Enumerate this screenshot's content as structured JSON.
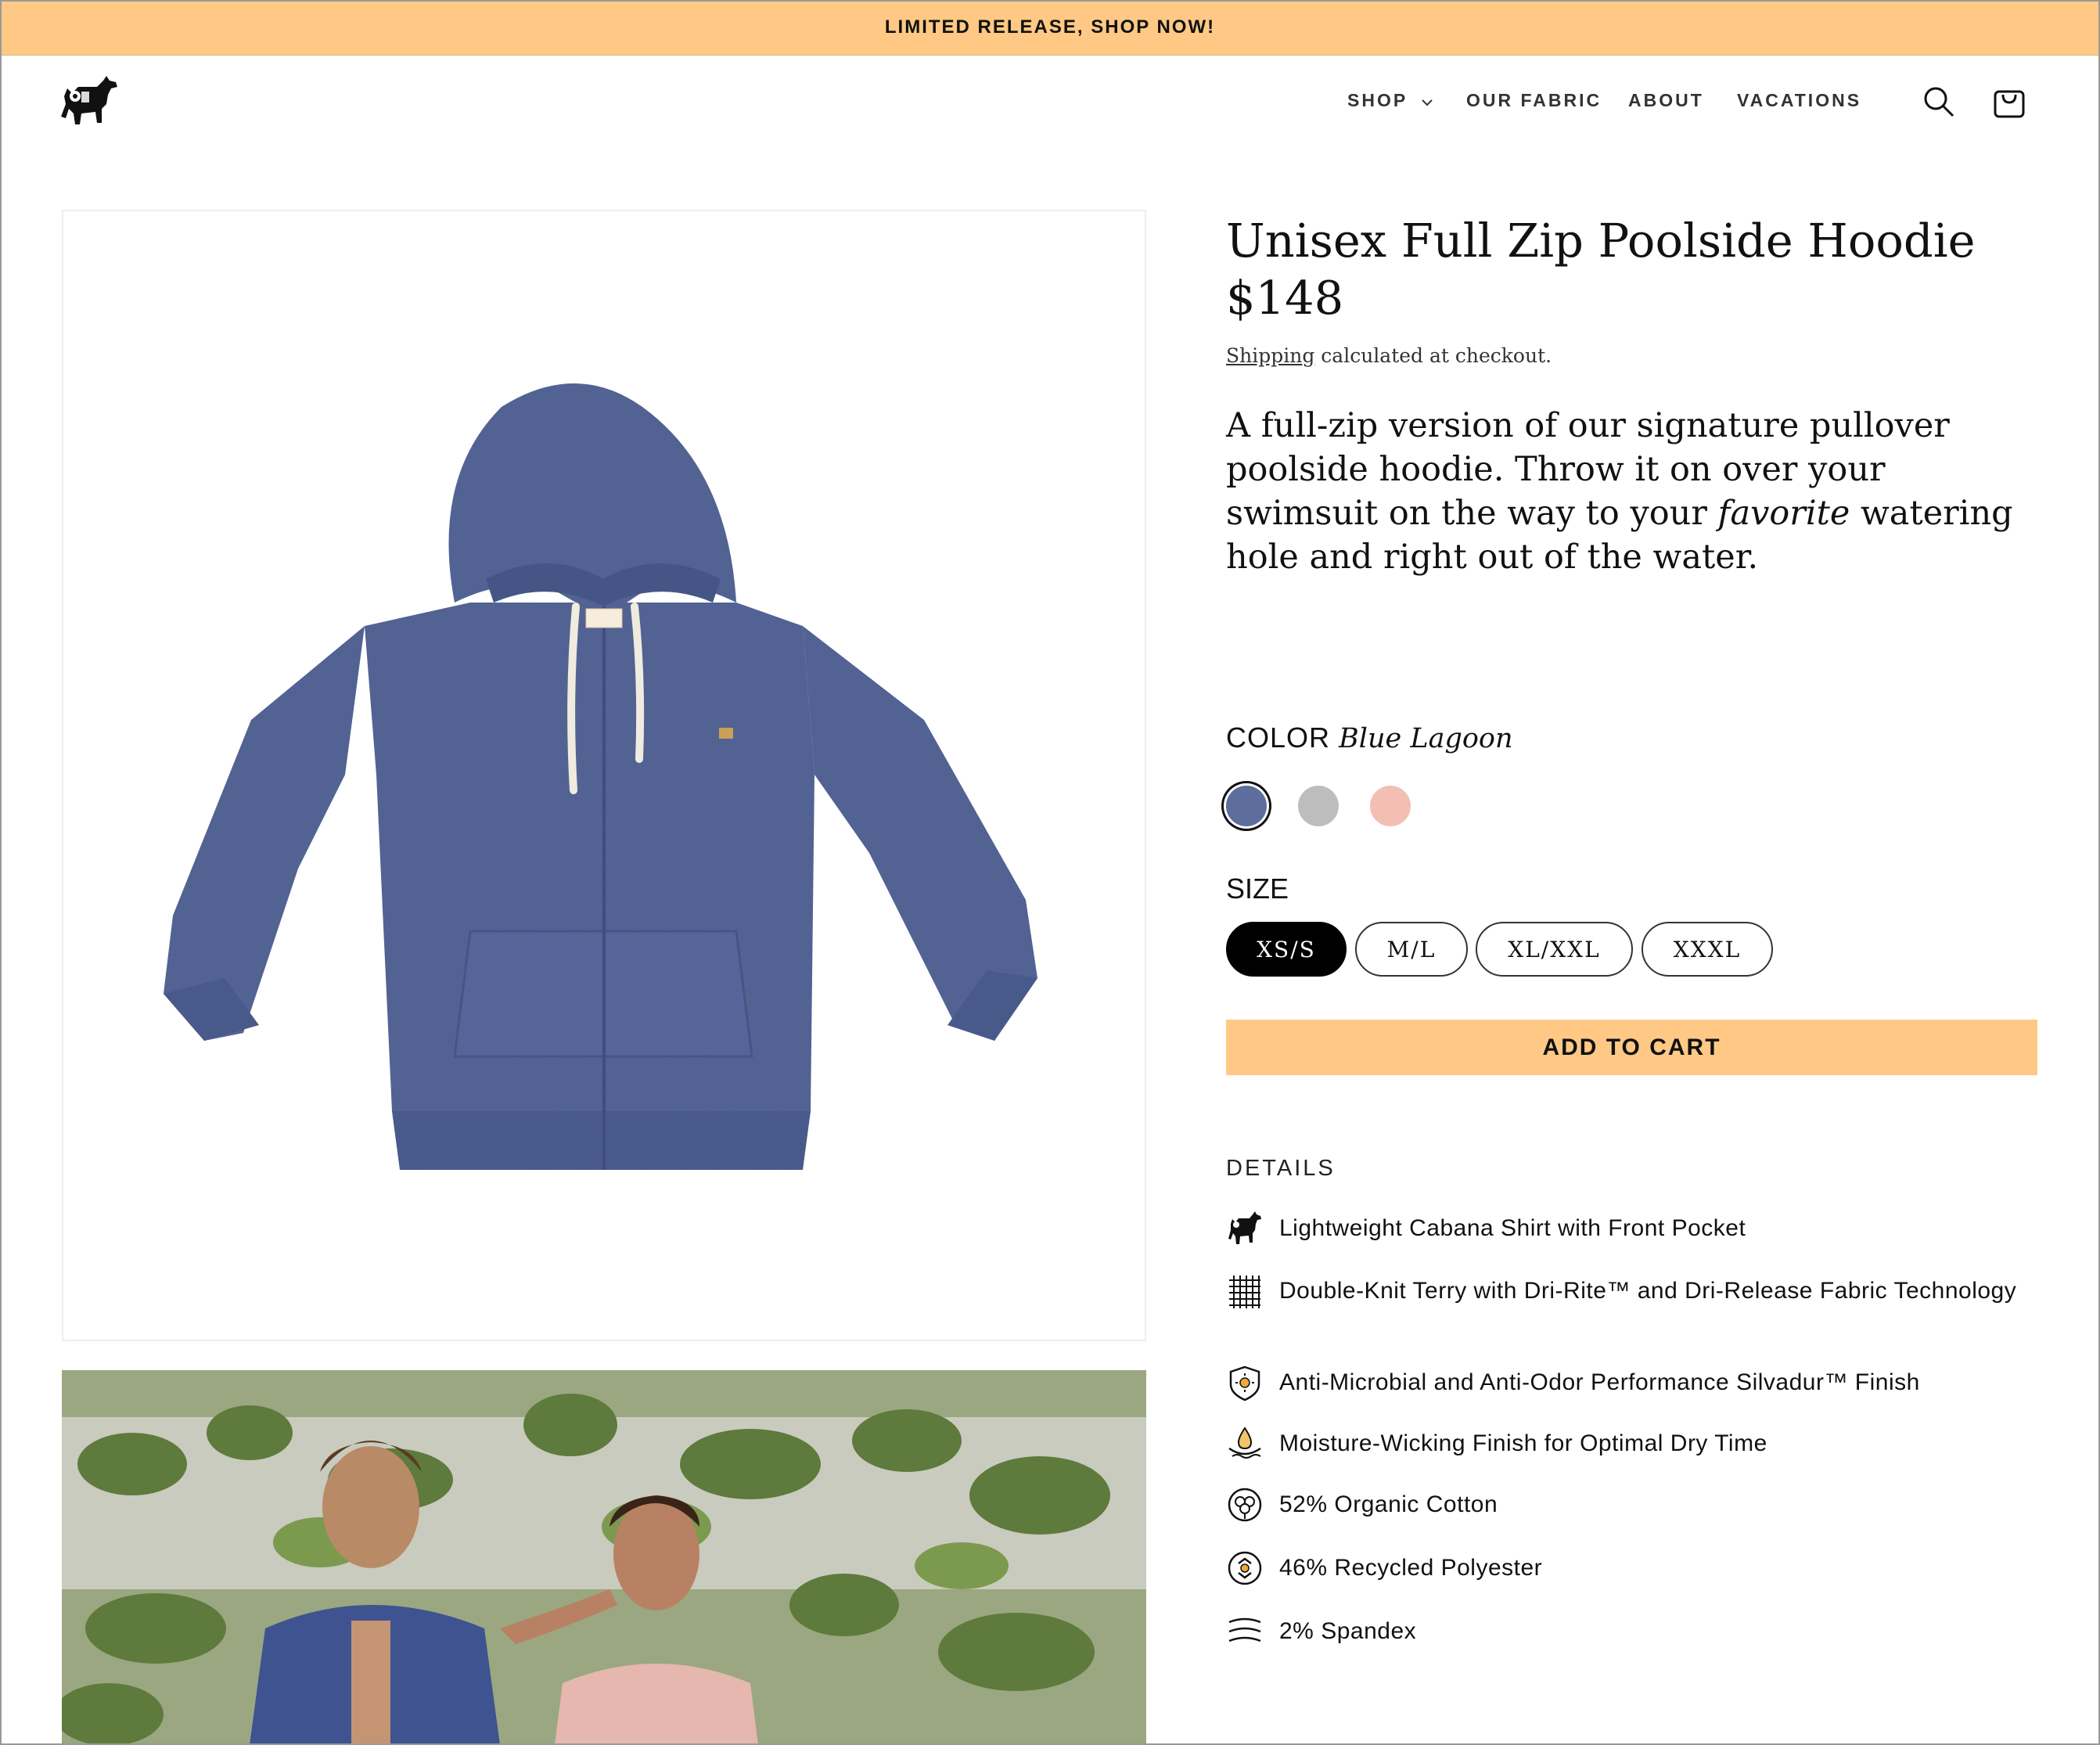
{
  "announcement": "LIMITED RELEASE, SHOP NOW!",
  "nav": {
    "items": [
      {
        "label": "SHOP",
        "has_dropdown": true
      },
      {
        "label": "OUR FABRIC"
      },
      {
        "label": "ABOUT"
      },
      {
        "label": "VACATIONS"
      }
    ],
    "icons": [
      "search-icon",
      "cart-icon"
    ]
  },
  "product": {
    "title": "Unisex Full Zip Poolside Hoodie",
    "price": "$148",
    "shipping_link": "Shipping",
    "shipping_rest": " calculated at checkout.",
    "description_before": "A full-zip version of our signature pullover poolside hoodie. Throw it on over your swimsuit on the way to your ",
    "description_italic": "favorite",
    "description_after": " watering hole and right out of the water.",
    "color_label": "COLOR",
    "color_value": "Blue Lagoon",
    "swatches": [
      {
        "color": "#5D6E9C",
        "selected": true
      },
      {
        "color": "#BDBDBD",
        "selected": false
      },
      {
        "color": "#F2BFB2",
        "selected": false
      }
    ],
    "size_label": "SIZE",
    "sizes": [
      {
        "label": "XS/S",
        "selected": true
      },
      {
        "label": "M/L",
        "selected": false
      },
      {
        "label": "XL/XXL",
        "selected": false
      },
      {
        "label": "XXXL",
        "selected": false
      }
    ],
    "add_to_cart": "ADD TO CART",
    "details_label": "DETAILS",
    "details": [
      {
        "icon": "goat-icon",
        "text": "Lightweight Cabana Shirt with Front Pocket"
      },
      {
        "icon": "fabric-grid-icon",
        "text": "Double-Knit Terry with Dri-Rite™ and Dri-Release Fabric Technology"
      },
      {
        "icon": "shield-sun-icon",
        "text": "Anti-Microbial and Anti-Odor Performance Silvadur™ Finish"
      },
      {
        "icon": "moisture-drop-icon",
        "text": "Moisture-Wicking Finish for Optimal Dry Time"
      },
      {
        "icon": "cotton-icon",
        "text": "52% Organic Cotton"
      },
      {
        "icon": "recycle-icon",
        "text": "46% Recycled Polyester"
      },
      {
        "icon": "stretch-icon",
        "text": "2% Spandex"
      }
    ]
  },
  "colors": {
    "accent": "#FFC985",
    "hoodie": "#56679A"
  }
}
